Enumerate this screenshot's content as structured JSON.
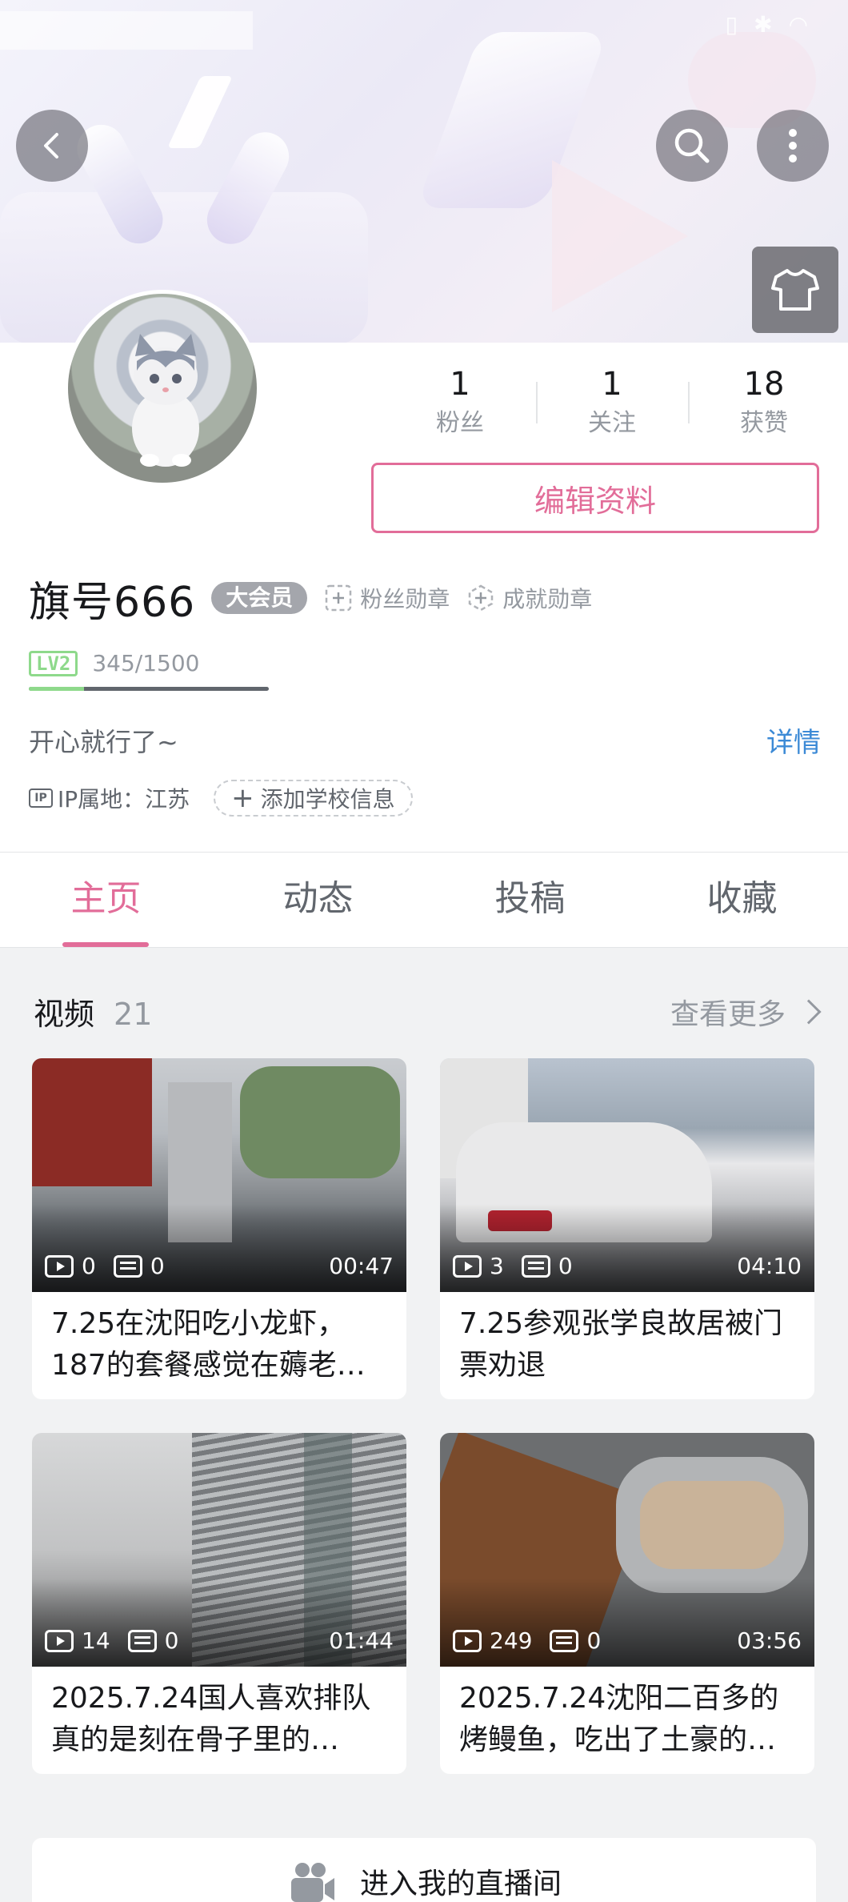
{
  "stats": [
    {
      "value": "1",
      "label": "粉丝"
    },
    {
      "value": "1",
      "label": "关注"
    },
    {
      "value": "18",
      "label": "获赞"
    }
  ],
  "edit_profile_label": "编辑资料",
  "profile": {
    "username": "旗号666",
    "vip_label": "大会员",
    "fan_medal_label": "粉丝勋章",
    "achievement_medal_label": "成就勋章",
    "level_badge": "LV2",
    "exp_text": "345/1500",
    "exp_progress": 0.23,
    "signature": "开心就行了~",
    "detail_label": "详情",
    "ip_icon_text": "IP",
    "ip_location": "IP属地：江苏",
    "add_school_label": "添加学校信息"
  },
  "tabs": [
    {
      "label": "主页",
      "active": true
    },
    {
      "label": "动态",
      "active": false
    },
    {
      "label": "投稿",
      "active": false
    },
    {
      "label": "收藏",
      "active": false
    }
  ],
  "videos_section": {
    "title": "视频",
    "count": "21",
    "more_label": "查看更多"
  },
  "videos": [
    {
      "plays": "0",
      "danmaku": "0",
      "duration": "00:47",
      "title": "7.25在沈阳吃小龙虾，187的套餐感觉在薅老…"
    },
    {
      "plays": "3",
      "danmaku": "0",
      "duration": "04:10",
      "title": "7.25参观张学良故居被门票劝退"
    },
    {
      "plays": "14",
      "danmaku": "0",
      "duration": "01:44",
      "title": "2025.7.24国人喜欢排队真的是刻在骨子里的…"
    },
    {
      "plays": "249",
      "danmaku": "0",
      "duration": "03:56",
      "title": "2025.7.24沈阳二百多的烤鳗鱼，吃出了土豪的…"
    }
  ],
  "live_room_label": "进入我的直播间",
  "colors": {
    "accent": "#e26d99",
    "link": "#3c8ad6",
    "level_green": "#8ed98b"
  },
  "icons": [
    "back-icon",
    "search-icon",
    "more-vertical-icon",
    "tshirt-icon",
    "play-icon",
    "danmaku-icon",
    "chevron-right-icon",
    "live-room-icon"
  ]
}
